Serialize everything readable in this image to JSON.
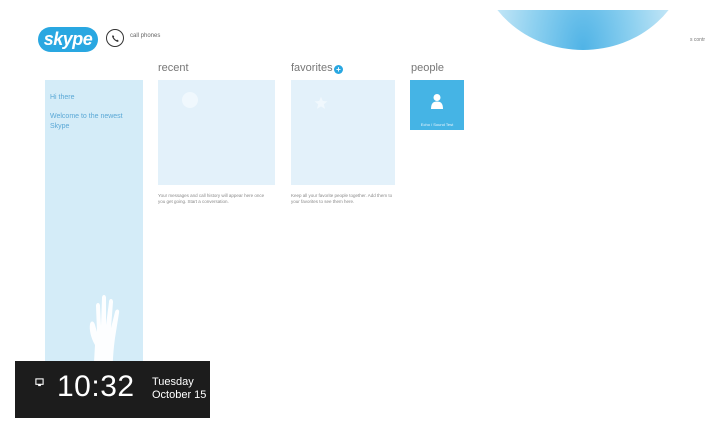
{
  "app": {
    "logo_text": "skype"
  },
  "header": {
    "call_phones_label": "call phones",
    "user_label": "s contr"
  },
  "sidebar": {
    "items": [
      {
        "label": "Hi there"
      },
      {
        "label": "Welcome to the newest Skype"
      }
    ]
  },
  "sections": {
    "recent": {
      "title": "recent",
      "description": "Your messages and call history will appear here once you get going. Start a conversation."
    },
    "favorites": {
      "title": "favorites",
      "add_icon_glyph": "+",
      "description": "Keep all your favorite people together. Add them to your favorites to see them here."
    },
    "people": {
      "title": "people",
      "contact_name": "Echo / Sound Test"
    }
  },
  "clock": {
    "time": "10:32",
    "day": "Tuesday",
    "date": "October 15"
  },
  "colors": {
    "brand": "#29a7e1",
    "panel": "#d4ecf8",
    "tile": "#e3f1fa",
    "clock_bg": "#1c1c1c"
  },
  "icons": [
    "phone-icon",
    "network-icon",
    "person-icon",
    "hand-icon",
    "add-icon"
  ]
}
